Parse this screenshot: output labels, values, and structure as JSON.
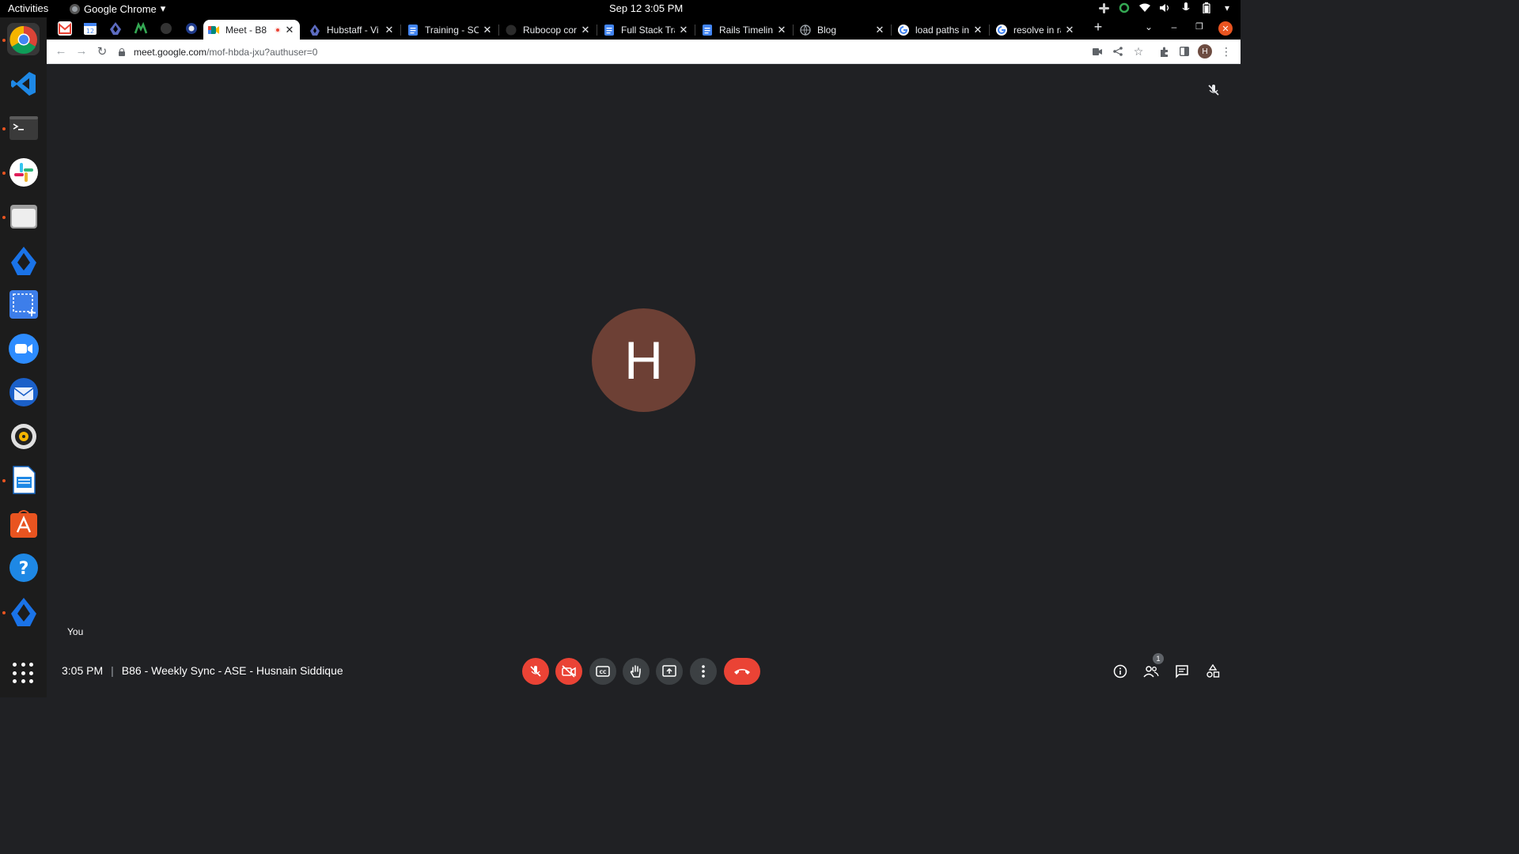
{
  "topbar": {
    "activities": "Activities",
    "app_name": "Google Chrome",
    "clock": "Sep 12  3:05 PM"
  },
  "colors": {
    "meet_bg": "#202124",
    "control_bg": "#3c4043",
    "danger": "#ea4335",
    "avatar": "#6d4035",
    "ubuntu_accent": "#e95420"
  },
  "dock": {
    "items": [
      {
        "icon": "chrome-icon"
      },
      {
        "icon": "vscode-icon"
      },
      {
        "icon": "terminal-icon"
      },
      {
        "icon": "slack-icon"
      },
      {
        "icon": "files-icon"
      },
      {
        "icon": "hubstaff-icon"
      },
      {
        "icon": "screenshot-icon"
      },
      {
        "icon": "zoom-icon"
      },
      {
        "icon": "thunderbird-icon"
      },
      {
        "icon": "rhythmbox-icon"
      },
      {
        "icon": "writer-icon"
      },
      {
        "icon": "software-center-icon"
      },
      {
        "icon": "help-icon"
      },
      {
        "icon": "hubstaff-icon"
      }
    ]
  },
  "tabs": [
    {
      "title": "Meet - B8",
      "active": true,
      "recording": true
    },
    {
      "title": "Hubstaff - Vi"
    },
    {
      "title": "Training - SO"
    },
    {
      "title": "Rubocop cor"
    },
    {
      "title": "Full Stack Tra"
    },
    {
      "title": "Rails Timelin"
    },
    {
      "title": "Blog"
    },
    {
      "title": "load paths in"
    },
    {
      "title": "resolve in rai"
    }
  ],
  "address": {
    "domain": "meet.google.com",
    "path": "/mof-hbda-jxu?authuser=0"
  },
  "profile_initial": "H",
  "meet": {
    "avatar_initial": "H",
    "self_label": "You",
    "time": "3:05 PM",
    "separator": "|",
    "meeting_title": "B86 - Weekly Sync - ASE - Husnain Siddique",
    "people_count": "1"
  }
}
